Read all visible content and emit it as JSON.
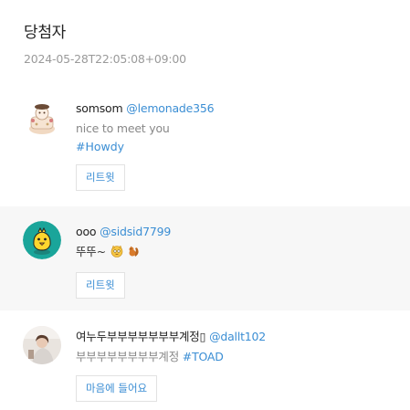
{
  "page": {
    "title": "당첨자",
    "timestamp": "2024-05-28T22:05:08+09:00"
  },
  "winners": [
    {
      "name": "somsom",
      "handle": "@lemonade356",
      "text": "nice to meet you",
      "hashtag": "#Howdy",
      "action_label": "리트윗",
      "avatar_icon": "cake-character-avatar"
    },
    {
      "name": "ooo",
      "handle": "@sidsid7799",
      "text": "뚜뚜~",
      "emojis": [
        "cat-face-emoji",
        "squirrel-emoji"
      ],
      "action_label": "리트윗",
      "avatar_icon": "yellow-chick-avatar"
    },
    {
      "name": "여누두부부부부부부부계정▯",
      "handle": "@dallt102",
      "text": "부부부부부부부부계정",
      "hashtag": "#TOAD",
      "action_label": "마음에 들어요",
      "avatar_icon": "person-photo-avatar"
    }
  ],
  "colors": {
    "link": "#3b8ed4",
    "highlight_row": "#f7f7f7",
    "muted_text": "#9a9a9a"
  }
}
